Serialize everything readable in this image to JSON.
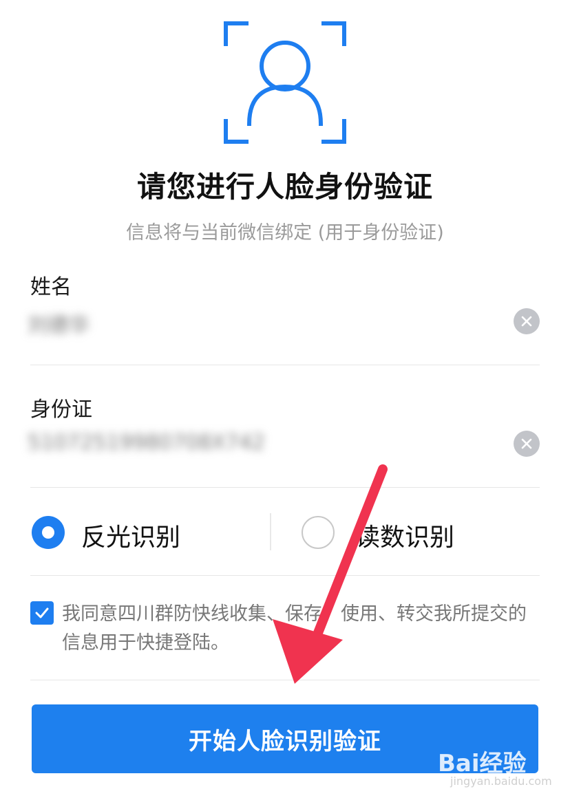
{
  "header": {
    "title": "请您进行人脸身份验证",
    "subtitle": "信息将与当前微信绑定 (用于身份验证)"
  },
  "form": {
    "name": {
      "label": "姓名",
      "value": "刘德华"
    },
    "id_card": {
      "label": "身份证",
      "value": "51072519980708X742"
    }
  },
  "recognition": {
    "options": [
      {
        "label": "反光识别",
        "selected": true
      },
      {
        "label": "读数识别",
        "selected": false
      }
    ]
  },
  "agreement": {
    "checked": true,
    "text": "我同意四川群防快线收集、保存、使用、转交我所提交的信息用于快捷登陆。"
  },
  "start_button": {
    "label": "开始人脸识别验证"
  },
  "watermark": {
    "logo": "Bai经验",
    "sub": "jingyan.baidu.com"
  },
  "colors": {
    "accent": "#1e7ef0",
    "annotation": "#f0334f"
  }
}
